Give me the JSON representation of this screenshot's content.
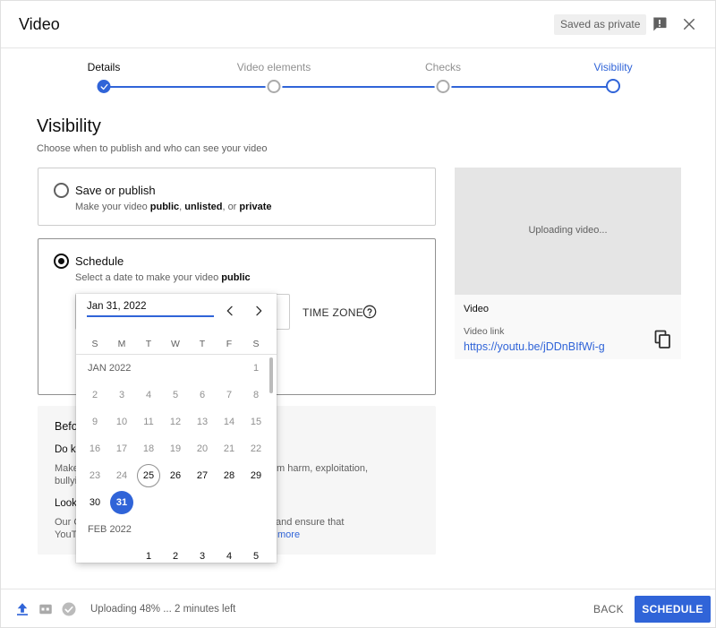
{
  "header": {
    "title": "Video",
    "saved_badge": "Saved as private"
  },
  "stepper": {
    "steps": [
      {
        "label": "Details",
        "state": "done"
      },
      {
        "label": "Video elements",
        "state": "pending"
      },
      {
        "label": "Checks",
        "state": "pending"
      },
      {
        "label": "Visibility",
        "state": "active"
      }
    ]
  },
  "visibility": {
    "title": "Visibility",
    "subtitle": "Choose when to publish and who can see your video",
    "save_or_publish": {
      "title": "Save or publish",
      "desc_prefix": "Make your video ",
      "desc_public": "public",
      "desc_sep1": ", ",
      "desc_unlisted": "unlisted",
      "desc_sep2": ", or ",
      "desc_private": "private",
      "selected": false
    },
    "schedule": {
      "title": "Schedule",
      "desc_prefix": "Select a date to make your video ",
      "desc_public": "public",
      "selected": true,
      "timezone_label": "TIME ZONE"
    }
  },
  "before_publish": {
    "heading": "Befo",
    "q1": "Do ki",
    "p1a": "Make",
    "p1a_tail": "m harm, exploitation,",
    "p1b": "bullyi",
    "q2": "Look",
    "p2a": "Our C",
    "p2a_tail": "and ensure that",
    "p2b": "YouT",
    "p2b_link": "more"
  },
  "preview": {
    "uploading": "Uploading video...",
    "video_label": "Video",
    "link_label": "Video link",
    "link": "https://youtu.be/jDDnBIfWi-g"
  },
  "calendar": {
    "input_value": "Jan 31, 2022",
    "weekdays": [
      "S",
      "M",
      "T",
      "W",
      "T",
      "F",
      "S"
    ],
    "month1": "JAN 2022",
    "month2": "FEB 2022",
    "jan_days": [
      "1",
      "2",
      "3",
      "4",
      "5",
      "6",
      "7",
      "8",
      "9",
      "10",
      "11",
      "12",
      "13",
      "14",
      "15",
      "16",
      "17",
      "18",
      "19",
      "20",
      "21",
      "22",
      "23",
      "24",
      "25",
      "26",
      "27",
      "28",
      "29",
      "30",
      "31"
    ],
    "feb_days": [
      "1",
      "2",
      "3",
      "4",
      "5"
    ],
    "today": "25",
    "selected": "31"
  },
  "footer": {
    "status": "Uploading 48% ... 2 minutes left",
    "back_label": "BACK",
    "schedule_label": "SCHEDULE"
  },
  "colors": {
    "accent": "#3064d8",
    "muted": "#606060"
  }
}
